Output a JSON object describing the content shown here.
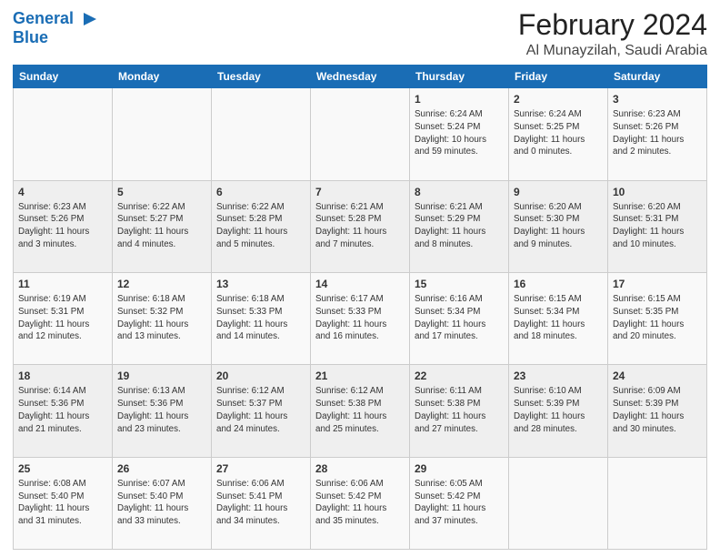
{
  "logo": {
    "line1": "General",
    "line2": "Blue",
    "icon": "▶"
  },
  "title": "February 2024",
  "location": "Al Munayzilah, Saudi Arabia",
  "headers": [
    "Sunday",
    "Monday",
    "Tuesday",
    "Wednesday",
    "Thursday",
    "Friday",
    "Saturday"
  ],
  "weeks": [
    [
      {
        "day": "",
        "info": ""
      },
      {
        "day": "",
        "info": ""
      },
      {
        "day": "",
        "info": ""
      },
      {
        "day": "",
        "info": ""
      },
      {
        "day": "1",
        "info": "Sunrise: 6:24 AM\nSunset: 5:24 PM\nDaylight: 10 hours\nand 59 minutes."
      },
      {
        "day": "2",
        "info": "Sunrise: 6:24 AM\nSunset: 5:25 PM\nDaylight: 11 hours\nand 0 minutes."
      },
      {
        "day": "3",
        "info": "Sunrise: 6:23 AM\nSunset: 5:26 PM\nDaylight: 11 hours\nand 2 minutes."
      }
    ],
    [
      {
        "day": "4",
        "info": "Sunrise: 6:23 AM\nSunset: 5:26 PM\nDaylight: 11 hours\nand 3 minutes."
      },
      {
        "day": "5",
        "info": "Sunrise: 6:22 AM\nSunset: 5:27 PM\nDaylight: 11 hours\nand 4 minutes."
      },
      {
        "day": "6",
        "info": "Sunrise: 6:22 AM\nSunset: 5:28 PM\nDaylight: 11 hours\nand 5 minutes."
      },
      {
        "day": "7",
        "info": "Sunrise: 6:21 AM\nSunset: 5:28 PM\nDaylight: 11 hours\nand 7 minutes."
      },
      {
        "day": "8",
        "info": "Sunrise: 6:21 AM\nSunset: 5:29 PM\nDaylight: 11 hours\nand 8 minutes."
      },
      {
        "day": "9",
        "info": "Sunrise: 6:20 AM\nSunset: 5:30 PM\nDaylight: 11 hours\nand 9 minutes."
      },
      {
        "day": "10",
        "info": "Sunrise: 6:20 AM\nSunset: 5:31 PM\nDaylight: 11 hours\nand 10 minutes."
      }
    ],
    [
      {
        "day": "11",
        "info": "Sunrise: 6:19 AM\nSunset: 5:31 PM\nDaylight: 11 hours\nand 12 minutes."
      },
      {
        "day": "12",
        "info": "Sunrise: 6:18 AM\nSunset: 5:32 PM\nDaylight: 11 hours\nand 13 minutes."
      },
      {
        "day": "13",
        "info": "Sunrise: 6:18 AM\nSunset: 5:33 PM\nDaylight: 11 hours\nand 14 minutes."
      },
      {
        "day": "14",
        "info": "Sunrise: 6:17 AM\nSunset: 5:33 PM\nDaylight: 11 hours\nand 16 minutes."
      },
      {
        "day": "15",
        "info": "Sunrise: 6:16 AM\nSunset: 5:34 PM\nDaylight: 11 hours\nand 17 minutes."
      },
      {
        "day": "16",
        "info": "Sunrise: 6:15 AM\nSunset: 5:34 PM\nDaylight: 11 hours\nand 18 minutes."
      },
      {
        "day": "17",
        "info": "Sunrise: 6:15 AM\nSunset: 5:35 PM\nDaylight: 11 hours\nand 20 minutes."
      }
    ],
    [
      {
        "day": "18",
        "info": "Sunrise: 6:14 AM\nSunset: 5:36 PM\nDaylight: 11 hours\nand 21 minutes."
      },
      {
        "day": "19",
        "info": "Sunrise: 6:13 AM\nSunset: 5:36 PM\nDaylight: 11 hours\nand 23 minutes."
      },
      {
        "day": "20",
        "info": "Sunrise: 6:12 AM\nSunset: 5:37 PM\nDaylight: 11 hours\nand 24 minutes."
      },
      {
        "day": "21",
        "info": "Sunrise: 6:12 AM\nSunset: 5:38 PM\nDaylight: 11 hours\nand 25 minutes."
      },
      {
        "day": "22",
        "info": "Sunrise: 6:11 AM\nSunset: 5:38 PM\nDaylight: 11 hours\nand 27 minutes."
      },
      {
        "day": "23",
        "info": "Sunrise: 6:10 AM\nSunset: 5:39 PM\nDaylight: 11 hours\nand 28 minutes."
      },
      {
        "day": "24",
        "info": "Sunrise: 6:09 AM\nSunset: 5:39 PM\nDaylight: 11 hours\nand 30 minutes."
      }
    ],
    [
      {
        "day": "25",
        "info": "Sunrise: 6:08 AM\nSunset: 5:40 PM\nDaylight: 11 hours\nand 31 minutes."
      },
      {
        "day": "26",
        "info": "Sunrise: 6:07 AM\nSunset: 5:40 PM\nDaylight: 11 hours\nand 33 minutes."
      },
      {
        "day": "27",
        "info": "Sunrise: 6:06 AM\nSunset: 5:41 PM\nDaylight: 11 hours\nand 34 minutes."
      },
      {
        "day": "28",
        "info": "Sunrise: 6:06 AM\nSunset: 5:42 PM\nDaylight: 11 hours\nand 35 minutes."
      },
      {
        "day": "29",
        "info": "Sunrise: 6:05 AM\nSunset: 5:42 PM\nDaylight: 11 hours\nand 37 minutes."
      },
      {
        "day": "",
        "info": ""
      },
      {
        "day": "",
        "info": ""
      }
    ]
  ]
}
